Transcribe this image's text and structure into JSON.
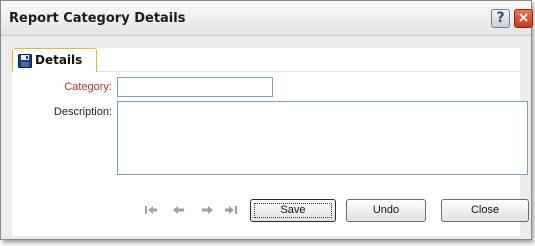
{
  "window": {
    "title": "Report Category Details"
  },
  "titlebar": {
    "help_label": "?",
    "close_label": "×"
  },
  "tab": {
    "label": "Details",
    "icon": "floppy-disk-icon"
  },
  "form": {
    "category_label": "Category:",
    "category_value": "",
    "description_label": "Description:",
    "description_value": ""
  },
  "navigation": {
    "icons": [
      "first-record-icon",
      "previous-record-icon",
      "next-record-icon",
      "last-record-icon"
    ]
  },
  "buttons": {
    "save": "Save",
    "undo": "Undo",
    "close": "Close"
  },
  "colors": {
    "required_label": "#b23434",
    "tab_border": "#f0b237",
    "input_border": "#7f9db9"
  }
}
